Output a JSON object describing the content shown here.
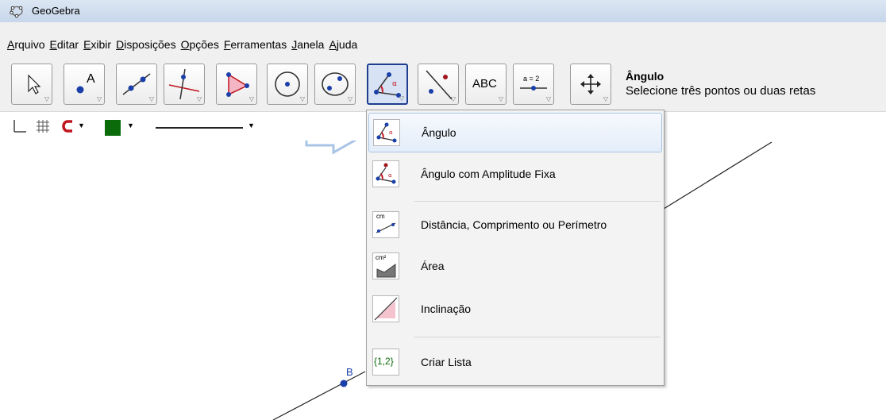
{
  "window": {
    "title": "GeoGebra"
  },
  "menu": [
    "Arquivo",
    "Editar",
    "Exibir",
    "Disposições",
    "Opções",
    "Ferramentas",
    "Janela",
    "Ajuda"
  ],
  "toolbar": {
    "tools": [
      {
        "name": "move-tool"
      },
      {
        "name": "point-tool",
        "text": "A"
      },
      {
        "name": "line-tool"
      },
      {
        "name": "perpendicular-tool"
      },
      {
        "name": "polygon-tool"
      },
      {
        "name": "circle-tool"
      },
      {
        "name": "conic-tool"
      },
      {
        "name": "angle-tool"
      },
      {
        "name": "reflect-tool"
      },
      {
        "name": "text-tool",
        "text": "ABC"
      },
      {
        "name": "slider-tool",
        "text": "a = 2"
      },
      {
        "name": "move-view-tool"
      }
    ],
    "selected_tool": "Ângulo",
    "selected_hint": "Selecione três pontos ou duas retas"
  },
  "dropdown": {
    "items": [
      {
        "label": "Ângulo",
        "icon": "angle-icon"
      },
      {
        "label": "Ângulo com Amplitude Fixa",
        "icon": "fixed-angle-icon"
      },
      {
        "label": "Distância, Comprimento ou Perímetro",
        "icon": "distance-icon",
        "icon_text": "cm"
      },
      {
        "label": "Área",
        "icon": "area-icon",
        "icon_text": "cm²"
      },
      {
        "label": "Inclinação",
        "icon": "slope-icon"
      },
      {
        "label": "Criar Lista",
        "icon": "list-icon",
        "icon_text": "{1,2}"
      }
    ]
  },
  "canvas": {
    "point_label": "B"
  },
  "colors": {
    "accent": "#1e3d8f",
    "point": "#1a3fa8",
    "red": "#c0141e",
    "green": "#0b6b0b"
  }
}
